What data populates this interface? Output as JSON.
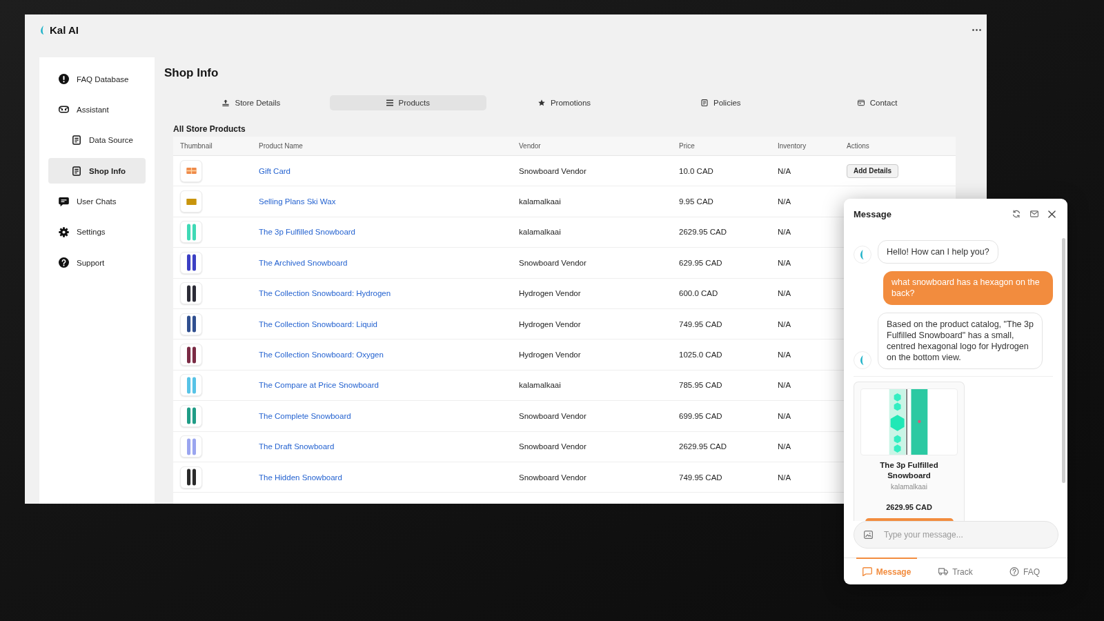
{
  "app": {
    "name": "Kal AI"
  },
  "sidebar": {
    "items": [
      {
        "label": "FAQ Database",
        "selected": false
      },
      {
        "label": "Assistant",
        "selected": false,
        "children": [
          {
            "label": "Data Source",
            "selected": false
          },
          {
            "label": "Shop Info",
            "selected": true
          }
        ]
      },
      {
        "label": "User Chats",
        "selected": false
      },
      {
        "label": "Settings",
        "selected": false
      },
      {
        "label": "Support",
        "selected": false
      }
    ]
  },
  "page": {
    "title": "Shop Info"
  },
  "tabs": [
    {
      "label": "Store Details",
      "selected": false
    },
    {
      "label": "Products",
      "selected": true
    },
    {
      "label": "Promotions",
      "selected": false
    },
    {
      "label": "Policies",
      "selected": false
    },
    {
      "label": "Contact",
      "selected": false
    }
  ],
  "products": {
    "title": "All Store Products",
    "columns": [
      "Thumbnail",
      "Product Name",
      "Vendor",
      "Price",
      "Inventory",
      "Actions"
    ],
    "rows": [
      {
        "thumbnail": {
          "kind": "gift_card",
          "color": "#ef8a4a"
        },
        "name": "Gift Card",
        "vendor": "Snowboard Vendor",
        "price": "10.0 CAD",
        "inventory": "N/A",
        "action": "Add Details"
      },
      {
        "thumbnail": {
          "kind": "wax",
          "color": "#c8940c"
        },
        "name": "Selling Plans Ski Wax",
        "vendor": "kalamalkaai",
        "price": "9.95 CAD",
        "inventory": "N/A"
      },
      {
        "thumbnail": {
          "kind": "snowboard",
          "color": "#3fd9b5"
        },
        "name": "The 3p Fulfilled Snowboard",
        "vendor": "kalamalkaai",
        "price": "2629.95 CAD",
        "inventory": "N/A"
      },
      {
        "thumbnail": {
          "kind": "snowboard",
          "color": "#3b3fc4"
        },
        "name": "The Archived Snowboard",
        "vendor": "Snowboard Vendor",
        "price": "629.95 CAD",
        "inventory": "N/A"
      },
      {
        "thumbnail": {
          "kind": "snowboard",
          "color": "#2b2b36"
        },
        "name": "The Collection Snowboard: Hydrogen",
        "vendor": "Hydrogen Vendor",
        "price": "600.0 CAD",
        "inventory": "N/A"
      },
      {
        "thumbnail": {
          "kind": "snowboard",
          "color": "#2f4f8f"
        },
        "name": "The Collection Snowboard: Liquid",
        "vendor": "Hydrogen Vendor",
        "price": "749.95 CAD",
        "inventory": "N/A"
      },
      {
        "thumbnail": {
          "kind": "snowboard",
          "color": "#7a2a44"
        },
        "name": "The Collection Snowboard: Oxygen",
        "vendor": "Hydrogen Vendor",
        "price": "1025.0 CAD",
        "inventory": "N/A"
      },
      {
        "thumbnail": {
          "kind": "snowboard",
          "color": "#57c3e6"
        },
        "name": "The Compare at Price Snowboard",
        "vendor": "kalamalkaai",
        "price": "785.95 CAD",
        "inventory": "N/A"
      },
      {
        "thumbnail": {
          "kind": "snowboard",
          "color": "#1f9c86"
        },
        "name": "The Complete Snowboard",
        "vendor": "Snowboard Vendor",
        "price": "699.95 CAD",
        "inventory": "N/A"
      },
      {
        "thumbnail": {
          "kind": "snowboard",
          "color": "#9aa5ef"
        },
        "name": "The Draft Snowboard",
        "vendor": "Snowboard Vendor",
        "price": "2629.95 CAD",
        "inventory": "N/A"
      },
      {
        "thumbnail": {
          "kind": "snowboard",
          "color": "#2a2a2a"
        },
        "name": "The Hidden Snowboard",
        "vendor": "Snowboard Vendor",
        "price": "749.95 CAD",
        "inventory": "N/A"
      }
    ]
  },
  "chat": {
    "title": "Message",
    "messages": [
      {
        "kind": "bot",
        "text": "Hello! How can I help you?"
      },
      {
        "kind": "user",
        "text": "what snowboard has a hexagon on the back?"
      },
      {
        "kind": "bot",
        "text": "Based on the product catalog, \"The 3p Fulfilled Snowboard\" has a small, centred hexagonal logo for Hydrogen on the bottom view."
      }
    ],
    "product_card": {
      "name": "The 3p Fulfilled Snowboard",
      "vendor": "kalamalkaai",
      "price": "2629.95 CAD"
    },
    "input": {
      "placeholder": "Type your message..."
    },
    "nav": [
      {
        "label": "Message",
        "selected": true
      },
      {
        "label": "Track",
        "selected": false
      },
      {
        "label": "FAQ",
        "selected": false
      }
    ]
  }
}
